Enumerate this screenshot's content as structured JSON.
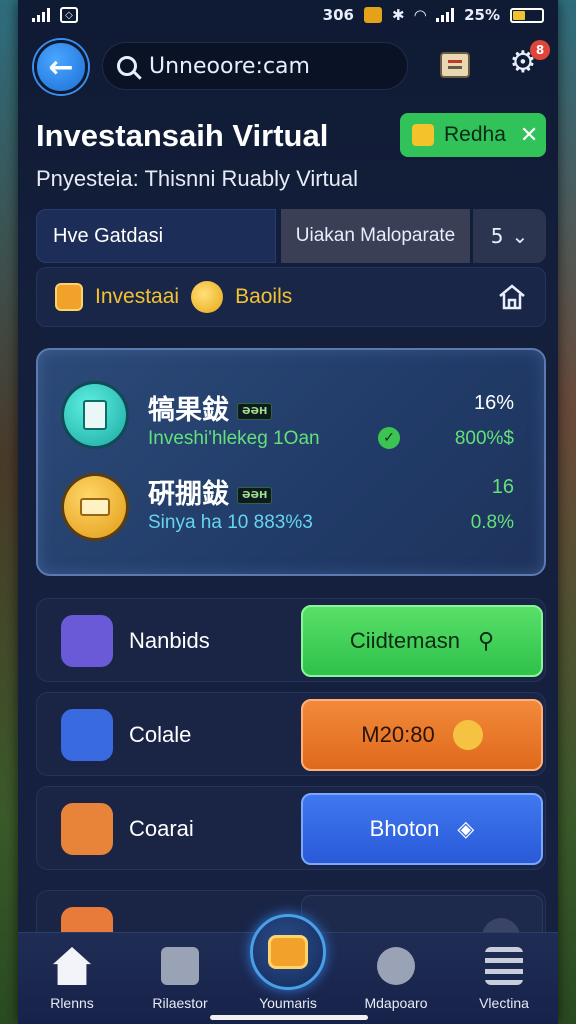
{
  "status_bar": {
    "time": "306",
    "battery": "25%"
  },
  "search": {
    "value": "Unneoore:cam"
  },
  "header": {
    "title": "Investansaih Virtual",
    "subtitle": "Pnyesteia: Thisnni Ruably Virtual",
    "redeem_label": "Redha",
    "notification_count": "8"
  },
  "tabs": {
    "primary": "Hve Gatdasi",
    "secondary": "Uiakan Maloparate",
    "count": "5"
  },
  "invest_bar": {
    "label_1": "Investaai",
    "label_2": "Baoils"
  },
  "stats": [
    {
      "title": "犒果鈸",
      "badge": "ƏƏH",
      "subtitle": "Inveshi'hlekeg 1Oan",
      "percent": "16%",
      "value": "800%$",
      "subtitle_color": "#63e07a",
      "value_color": "#63e07a"
    },
    {
      "title": "硏掤鈸",
      "badge": "ƏƏH",
      "subtitle": "Sinya ha 10 883%3",
      "percent": "16",
      "value": "0.8%",
      "subtitle_color": "#66d4f0",
      "value_color": "#63e07a"
    }
  ],
  "features": [
    {
      "label": "Nanbids",
      "button": "Ciidtemasn",
      "icon": "tools-icon",
      "icon_color": "#6a5ad8"
    },
    {
      "label": "Colale",
      "button": "M20:80",
      "icon": "music-icon",
      "icon_color": "#3a6ae0"
    },
    {
      "label": "Coarai",
      "button": "Bhoton",
      "icon": "document-icon",
      "icon_color": "#e8843a"
    }
  ],
  "nav": [
    {
      "label": "Rlenns",
      "icon": "home-icon"
    },
    {
      "label": "Rilaestor",
      "icon": "calendar-icon"
    },
    {
      "label": "Youmaris",
      "icon": "wallet-icon"
    },
    {
      "label": "Mdapoaro",
      "icon": "gear-icon"
    },
    {
      "label": "Vlectina",
      "icon": "menu-icon"
    }
  ],
  "colors": {
    "accent_green": "#32c25a",
    "accent_orange": "#e06a1c",
    "accent_blue": "#2a5ad8",
    "background": "#141f3c"
  }
}
